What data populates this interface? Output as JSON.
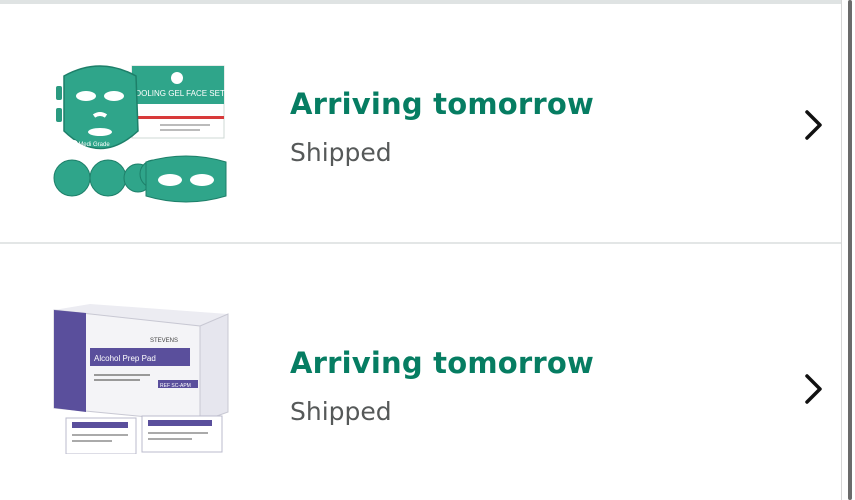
{
  "orders": [
    {
      "product_alt": "Cooling gel face mask set",
      "status": "Arriving tomorrow",
      "substatus": "Shipped",
      "package_title": "COOLING GEL FACE SET",
      "brand": "Medi Grade",
      "accent": "#2fa58a"
    },
    {
      "product_alt": "Alcohol prep pads box",
      "status": "Arriving tomorrow",
      "substatus": "Shipped",
      "brand": "STEVENS",
      "package_title": "Alcohol Prep Pad",
      "package_sub": "Tampon de préparation à l'alcool",
      "ref": "REF SC-APM",
      "accent": "#5a4f9c"
    }
  ],
  "colors": {
    "status_green": "#067d62",
    "substatus_gray": "#565959",
    "divider": "#e3e6e6"
  },
  "icons": {
    "chevron": "chevron-right-icon"
  }
}
